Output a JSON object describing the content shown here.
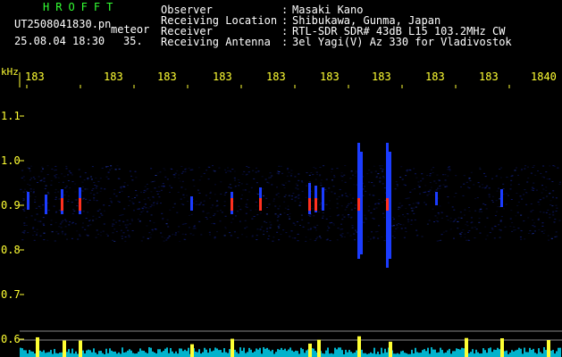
{
  "header": {
    "program": "HROFFT",
    "filename": "UT2508041830.pn",
    "event_label": "meteor",
    "datetime": "25.08.04 18:30",
    "count": "35.",
    "field_labels": [
      "Observer",
      "Receiving Location",
      "Receiver",
      "Receiving Antenna"
    ],
    "separators": [
      ":",
      ":",
      ":",
      ":"
    ],
    "field_values": [
      "Masaki Kano",
      "Shibukawa, Gunma, Japan",
      "RTL-SDR SDR# 43dB L15 103.2MHz CW",
      "3el Yagi(V) Az 330 for Vladivostok"
    ]
  },
  "axes": {
    "y_unit": "kHz",
    "y_ticks": [
      "1.1",
      "1.0",
      "0.9",
      "0.8",
      "0.7",
      "0.6"
    ],
    "x_ticks": [
      "183",
      "183",
      "183",
      "183",
      "183",
      "183",
      "183",
      "183",
      "183",
      "1840"
    ]
  },
  "colors": {
    "background": "#000000",
    "header_green": "#33ff33",
    "header_white": "#ffffff",
    "axis_yellow": "#ffff33",
    "signal_blue": "#1b3cff",
    "signal_red": "#ff3020",
    "meter_cyan": "#00e0ff"
  }
}
